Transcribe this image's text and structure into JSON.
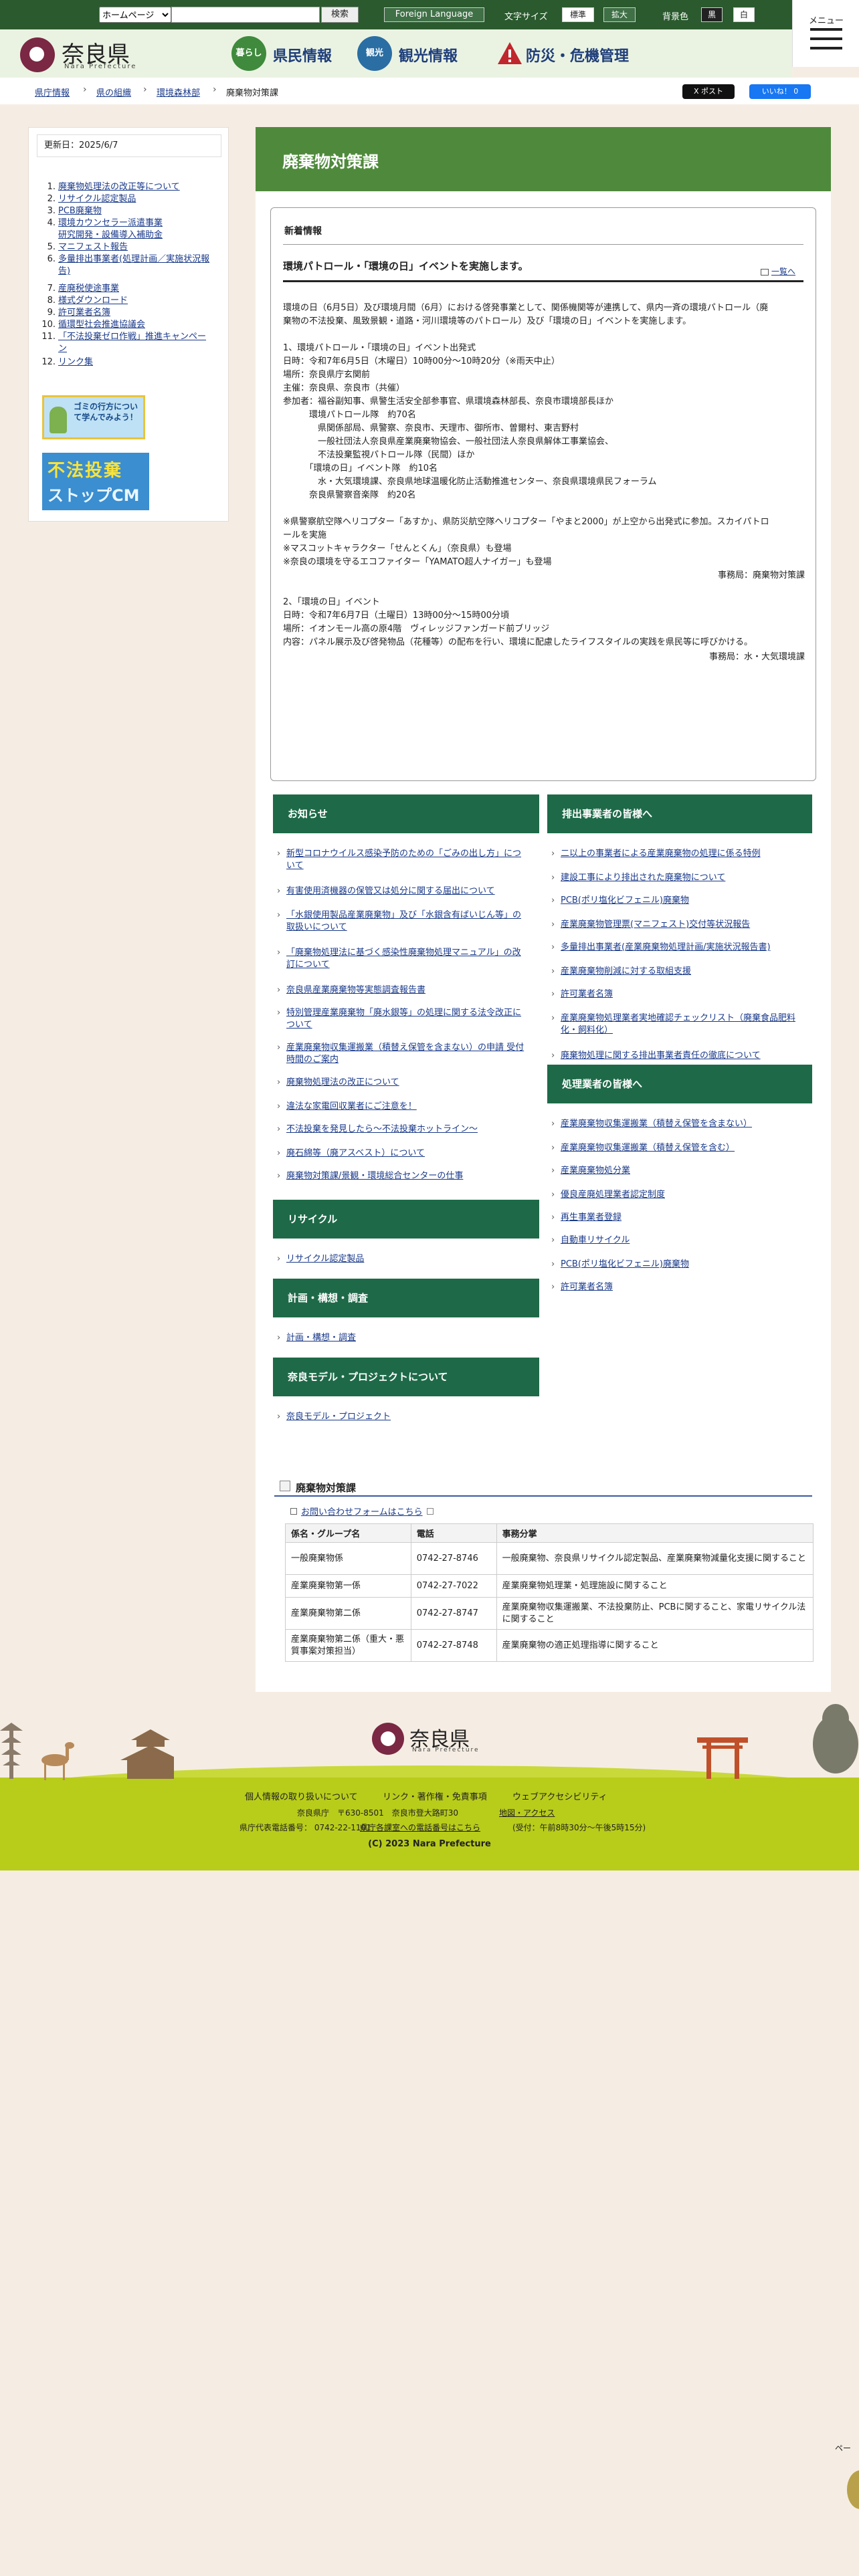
{
  "topbar": {
    "select_value": "ホームページ",
    "search_button": "検索",
    "foreign_language": "Foreign Language",
    "font_size_label": "文字サイズ",
    "font_standard": "標準",
    "font_large": "拡大",
    "bg_label": "背景色",
    "bg_black": "黒",
    "bg_white": "白",
    "menu_label": "メニュー"
  },
  "header": {
    "logo_name": "奈良県",
    "logo_en": "Nara Prefecture",
    "nav": [
      {
        "icon_text": "暮らし",
        "label": "県民情報",
        "icon_color": "#3f8a3c"
      },
      {
        "icon_text": "観光",
        "label": "観光情報",
        "icon_color": "#2a6ea3"
      },
      {
        "icon_text": "!",
        "label": "防災・危機管理",
        "icon_color": "#c0262d"
      }
    ]
  },
  "breadcrumb": [
    "県庁情報",
    "県の組織",
    "環境森林部",
    "廃棄物対策課"
  ],
  "share": {
    "post": "X ポスト",
    "like": "いいね！ 0"
  },
  "sidebar": {
    "updated": "更新日：2025/6/7",
    "items": [
      {
        "num": "1.",
        "text": "廃棄物処理法の改正等について"
      },
      {
        "num": "2.",
        "text": "リサイクル認定製品"
      },
      {
        "num": "3.",
        "text": "PCB廃棄物"
      },
      {
        "num": "4.",
        "text": "環境カウンセラー派遣事業"
      },
      {
        "num": "",
        "text": "研究開発・設備導入補助金"
      },
      {
        "num": "5.",
        "text": "マニフェスト報告"
      },
      {
        "num": "6.",
        "text": "多量排出事業者(処理計画／実施状況報"
      },
      {
        "num": "",
        "text": "告)"
      },
      {
        "num": "7.",
        "text": "産廃税使途事業"
      },
      {
        "num": "8.",
        "text": "様式ダウンロード"
      },
      {
        "num": "9.",
        "text": "許可業者名簿"
      },
      {
        "num": "10.",
        "text": "循環型社会推進協議会"
      },
      {
        "num": "11.",
        "text": "「不法投棄ゼロ作戦」推進キャンペー"
      },
      {
        "num": "",
        "text": "ン"
      },
      {
        "num": "12.",
        "text": "リンク集"
      }
    ],
    "banner1": "ゴミの行方について学んでみよう！",
    "banner2_line1": "不法投棄",
    "banner2_line2": "ストップCM"
  },
  "main": {
    "title": "廃棄物対策課",
    "news_heading": "新着情報",
    "news_title": "環境パトロール・「環境の日」イベントを実施します。",
    "news_all": "一覧へ",
    "news_lines": [
      "環境の日（6月5日）及び環境月間（6月）における啓発事業として、関係機関等が連携して、県内一斉の環境パトロール（廃",
      "棄物の不法投棄、風致景観・道路・河川環境等のパトロール）及び「環境の日」イベントを実施します。",
      "1、環境パトロール・「環境の日」イベント出発式",
      "日時：令和7年6月5日（木曜日）10時00分～10時20分（※雨天中止）",
      "場所：奈良県庁玄関前",
      "主催：奈良県、奈良市（共催）",
      "参加者：福谷副知事、県警生活安全部参事官、県環境森林部長、奈良市環境部長ほか",
      "　　　環境パトロール隊　約70名",
      "　　　　県関係部局、県警察、奈良市、天理市、御所市、曽爾村、東吉野村",
      "　　　　一般社団法人奈良県産業廃棄物協会、一般社団法人奈良県解体工事業協会、",
      "　　　　不法投棄監視パトロール隊（民間）ほか",
      "　　　「環境の日」イベント隊　約10名",
      "　　　　水・大気環境課、奈良県地球温暖化防止活動推進センター、奈良県環境県民フォーラム",
      "　　　奈良県警察音楽隊　約20名",
      "※県警察航空隊ヘリコプター「あすか」、県防災航空隊ヘリコプター「やまと2000」が上空から出発式に参加。スカイパトロ",
      "ールを実施",
      "※マスコットキャラクター「せんとくん」（奈良県）も登場",
      "※奈良の環境を守るエコファイター「YAMATO超人ナイガー」も登場",
      "事務局：廃棄物対策課",
      "2、「環境の日」イベント",
      "日時：令和7年6月7日（土曜日）13時00分～15時00分頃",
      "場所：イオンモール高の原4階　ヴィレッジファンガード前ブリッジ",
      "内容：パネル展示及び啓発物品（花種等）の配布を行い、環境に配慮したライフスタイルの実践を県民等に呼びかける。",
      "事務局：水・大気環境課"
    ],
    "groups": {
      "oshirase": {
        "title": "お知らせ",
        "items": [
          "新型コロナウイルス感染予防のための「ごみの出し方」について",
          "有害使用済機器の保管又は処分に関する届出について",
          "「水銀使用製品産業廃棄物」及び「水銀含有ばいじん等」の取扱いについて",
          "「廃棄物処理法に基づく感染性廃棄物処理マニュアル」の改訂について",
          "奈良県産業廃棄物等実態調査報告書",
          "特別管理産業廃棄物「廃水銀等」の処理に関する法令改正について",
          "産業廃棄物収集運搬業（積替え保管を含まない）の申請 受付時間のご案内",
          "廃棄物処理法の改正について",
          "違法な家電回収業者にご注意を！",
          "不法投棄を発見したら～不法投棄ホットライン～",
          "廃石綿等（廃アスベスト）について",
          "廃棄物対策課/景観・環境総合センターの仕事"
        ]
      },
      "haishutsu": {
        "title": "排出事業者の皆様へ",
        "items": [
          "二以上の事業者による産業廃棄物の処理に係る特例",
          "建設工事により排出された廃棄物について",
          "PCB(ポリ塩化ビフェニル)廃棄物",
          "産業廃棄物管理票(マニフェスト)交付等状況報告",
          "多量排出事業者(産業廃棄物処理計画/実施状況報告書)",
          "産業廃棄物削減に対する取組支援",
          "許可業者名簿",
          "産業廃棄物処理業者実地確認チェックリスト（廃棄食品肥料化・飼料化）",
          "廃棄物処理に関する排出事業者責任の徹底について"
        ]
      },
      "shori": {
        "title": "処理業者の皆様へ",
        "items": [
          "産業廃棄物収集運搬業（積替え保管を含まない）",
          "産業廃棄物収集運搬業（積替え保管を含む）",
          "産業廃棄物処分業",
          "優良産廃処理業者認定制度",
          "再生事業者登録",
          "自動車リサイクル",
          "PCB(ポリ塩化ビフェニル)廃棄物",
          "許可業者名簿"
        ]
      },
      "recycle": {
        "title": "リサイクル",
        "items": [
          "リサイクル認定製品"
        ]
      },
      "keikaku": {
        "title": "計画・構想・調査",
        "items": [
          "計画・構想・調査"
        ]
      },
      "model": {
        "title": "奈良モデル・プロジェクトについて",
        "items": [
          "奈良モデル・プロジェクト"
        ]
      }
    },
    "contact": {
      "title": "廃棄物対策課",
      "form_link": "お問い合わせフォームはこちら",
      "headers": [
        "係名・グループ名",
        "電話",
        "事務分掌"
      ],
      "rows": [
        [
          "一般廃棄物係",
          "0742-27-8746",
          "一般廃棄物、奈良県リサイクル認定製品、産業廃棄物減量化支援に関すること"
        ],
        [
          "産業廃棄物第一係",
          "0742-27-7022",
          "産業廃棄物処理業・処理施設に関すること"
        ],
        [
          "産業廃棄物第二係",
          "0742-27-8747",
          "産業廃棄物収集運搬業、不法投棄防止、PCBに関すること、家電リサイクル法に関すること"
        ],
        [
          "産業廃棄物第二係（重大・悪質事案対策担当）",
          "0742-27-8748",
          "産業廃棄物の適正処理指導に関すること"
        ]
      ]
    }
  },
  "footer": {
    "logo_name": "奈良県",
    "logo_en": "Nara Prefecture",
    "links": [
      "個人情報の取り扱いについて",
      "リンク・著作権・免責事項",
      "ウェブアクセシビリティ"
    ],
    "address": "奈良県庁　〒630-8501　奈良市登大路町30",
    "map_link": "地図・アクセス",
    "phone": "県庁代表電話番号： 0742-22-1101",
    "phone_link": "県庁各課室への電話番号はこちら",
    "hours": "(受付：午前8時30分～午後5時15分)",
    "copyright": "(C) 2023 Nara Prefecture"
  },
  "page_top": "ペー",
  "colors": {
    "brand_green": "#4f8a3c",
    "group_header": "#1e6a48",
    "footer_band": "#b8cc1a",
    "logo": "#7a2844"
  }
}
